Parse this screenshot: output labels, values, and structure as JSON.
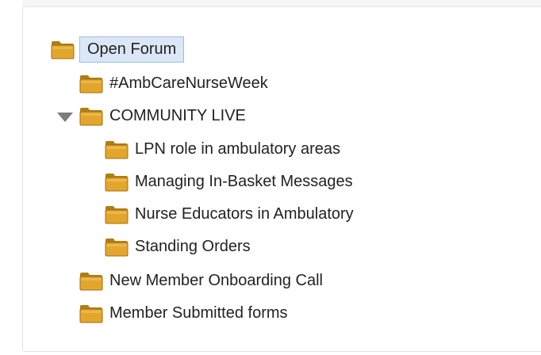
{
  "tree": {
    "root": {
      "label": "Open Forum",
      "selected": true,
      "icon": "folder-icon"
    },
    "items": [
      {
        "label": "#AmbCareNurseWeek",
        "icon": "folder-icon"
      },
      {
        "label": "COMMUNITY LIVE",
        "icon": "folder-icon",
        "expanded": true,
        "children": [
          {
            "label": "LPN role in ambulatory areas",
            "icon": "folder-icon"
          },
          {
            "label": "Managing In-Basket Messages",
            "icon": "folder-icon"
          },
          {
            "label": "Nurse Educators in Ambulatory",
            "icon": "folder-icon"
          },
          {
            "label": "Standing Orders",
            "icon": "folder-icon"
          }
        ]
      },
      {
        "label": "New Member Onboarding Call",
        "icon": "folder-icon"
      },
      {
        "label": "Member Submitted forms",
        "icon": "folder-icon"
      }
    ],
    "toggle_icon": "triangle-down-icon"
  },
  "colors": {
    "folder_body": "#e3a62c",
    "folder_dark": "#b07d16",
    "selection_bg": "#dbe7f6",
    "selection_border": "#9cbce0"
  }
}
